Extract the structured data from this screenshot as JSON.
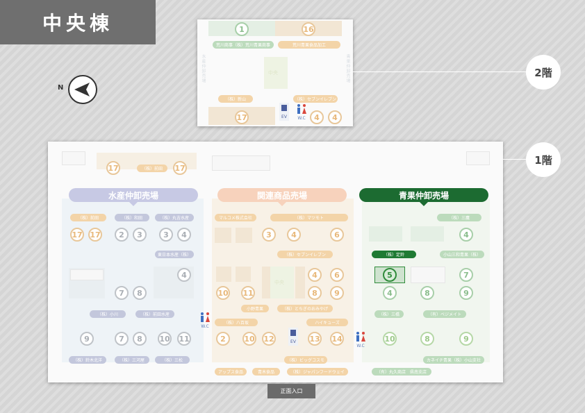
{
  "building_title": "中央棟",
  "compass_label": "N",
  "floors": [
    {
      "id": "2F",
      "label": "2階"
    },
    {
      "id": "1F",
      "label": "1階"
    }
  ],
  "floor2": {
    "numbers": [
      "1",
      "16",
      "17",
      "4",
      "4"
    ],
    "pills": [
      "荒川商事（株）荒川青果商事",
      "荒川青果食品加工",
      "（株）新山",
      "（株）セブンイレブン"
    ],
    "center_label": "中央",
    "ev_label": "EV",
    "wc_label": "W.C"
  },
  "floor1": {
    "sections": [
      {
        "name": "水産仲卸売場"
      },
      {
        "name": "関連商品売場"
      },
      {
        "name": "青果仲卸売場"
      }
    ],
    "top_numbers": [
      "17",
      "17"
    ],
    "top_pill": "（株）前田",
    "suisan": {
      "pills": [
        "（株）前田",
        "（株）和田",
        "（株）丸吉水産",
        "東日本水産（株）",
        "（株）小川",
        "（株）前田水産",
        "（株）鈴木北洋",
        "（株）三河屋",
        "（株）三松"
      ],
      "numbers": [
        "17",
        "17",
        "2",
        "3",
        "3",
        "4",
        "4",
        "7",
        "8",
        "9",
        "7",
        "8",
        "10",
        "11"
      ]
    },
    "kanren": {
      "pills": [
        "マルコメ株式会社",
        "（株）マツモト",
        "（株）セブンイレブン",
        "（株）マルヤマ",
        "小野青果",
        "（株）とちぎのおみやげ",
        "（株）八百坂",
        "ハイキューズ",
        "（株）ビッグコスモ",
        "アップス食品",
        "青木食品",
        "（株）ジャパンフードウェイ"
      ],
      "numbers": [
        "3",
        "4",
        "6",
        "4",
        "6",
        "10",
        "11",
        "8",
        "9",
        "2",
        "10",
        "12",
        "13",
        "14"
      ],
      "center_label": "中央"
    },
    "seika": {
      "pills": [
        "（株）三鷹",
        "小山三和青果（株）",
        "（株）三橋",
        "（有）ベジメイト",
        "カネイチ青果（株）小山支社",
        "（有）丸久商店　県南支店"
      ],
      "highlight_pill": "（株）定鈴",
      "highlight_number": "5",
      "numbers": [
        "4",
        "7",
        "4",
        "8",
        "9",
        "10",
        "8",
        "9"
      ]
    },
    "ev_label": "EV",
    "wc_label": "W.C"
  },
  "entrance_label": "正面入口",
  "colors": {
    "title_bg": "#6f6f6f",
    "seika_header": "#1c6b31",
    "highlight": "#2f8b3a",
    "suisan_header": "#c7c9e4",
    "kanren_header": "#f7d2bc"
  }
}
